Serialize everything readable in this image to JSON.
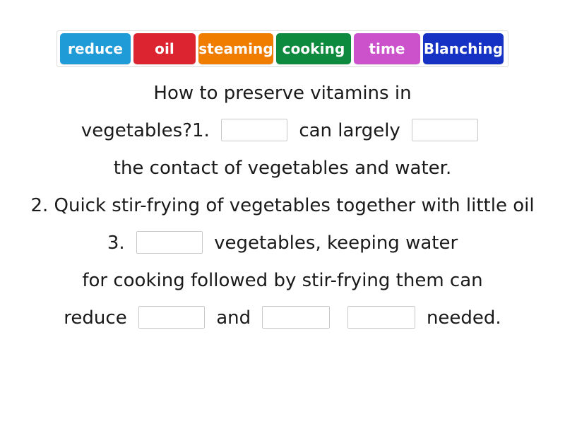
{
  "activity": {
    "type": "fill-in-the-blanks-drag-and-drop",
    "title_text": "How to preserve vitamins in vegetables?"
  },
  "word_bank": {
    "tiles": [
      {
        "label": "reduce",
        "color": "#1f9bd8"
      },
      {
        "label": "oil",
        "color": "#dc2431"
      },
      {
        "label": "steaming",
        "color": "#f07d00"
      },
      {
        "label": "cooking",
        "color": "#0e8a3e"
      },
      {
        "label": "time",
        "color": "#cc52cc"
      },
      {
        "label": "Blanching",
        "color": "#1632c4"
      }
    ]
  },
  "lines": [
    {
      "segments": [
        {
          "kind": "text",
          "value": "How to preserve vitamins in"
        }
      ]
    },
    {
      "segments": [
        {
          "kind": "text",
          "value": "vegetables?1."
        },
        {
          "kind": "blank",
          "value": ""
        },
        {
          "kind": "text",
          "value": "can largely"
        },
        {
          "kind": "blank",
          "value": ""
        }
      ]
    },
    {
      "segments": [
        {
          "kind": "text",
          "value": "the contact of vegetables and water."
        }
      ]
    },
    {
      "segments": [
        {
          "kind": "text",
          "value": "2. Quick stir-frying of vegetables together with little oil"
        }
      ]
    },
    {
      "segments": [
        {
          "kind": "text",
          "value": "3."
        },
        {
          "kind": "blank",
          "value": ""
        },
        {
          "kind": "text",
          "value": "vegetables, keeping water"
        }
      ]
    },
    {
      "segments": [
        {
          "kind": "text",
          "value": "for cooking followed by stir-frying them can"
        }
      ]
    },
    {
      "segments": [
        {
          "kind": "text",
          "value": "reduce"
        },
        {
          "kind": "blank",
          "value": ""
        },
        {
          "kind": "text",
          "value": "and"
        },
        {
          "kind": "blank",
          "value": ""
        },
        {
          "kind": "blank",
          "value": ""
        },
        {
          "kind": "text",
          "value": "needed."
        }
      ]
    }
  ],
  "line_text": {
    "l0": "How to preserve vitamins in",
    "l1a": "vegetables?1.",
    "l1b": "can largely",
    "l2": "the contact of vegetables and water.",
    "l3": "2. Quick stir-frying of vegetables together with little oil",
    "l4a": "3.",
    "l4b": "vegetables, keeping water",
    "l5": "for cooking followed by stir-frying them can",
    "l6a": "reduce",
    "l6b": "and",
    "l6c": "needed."
  }
}
